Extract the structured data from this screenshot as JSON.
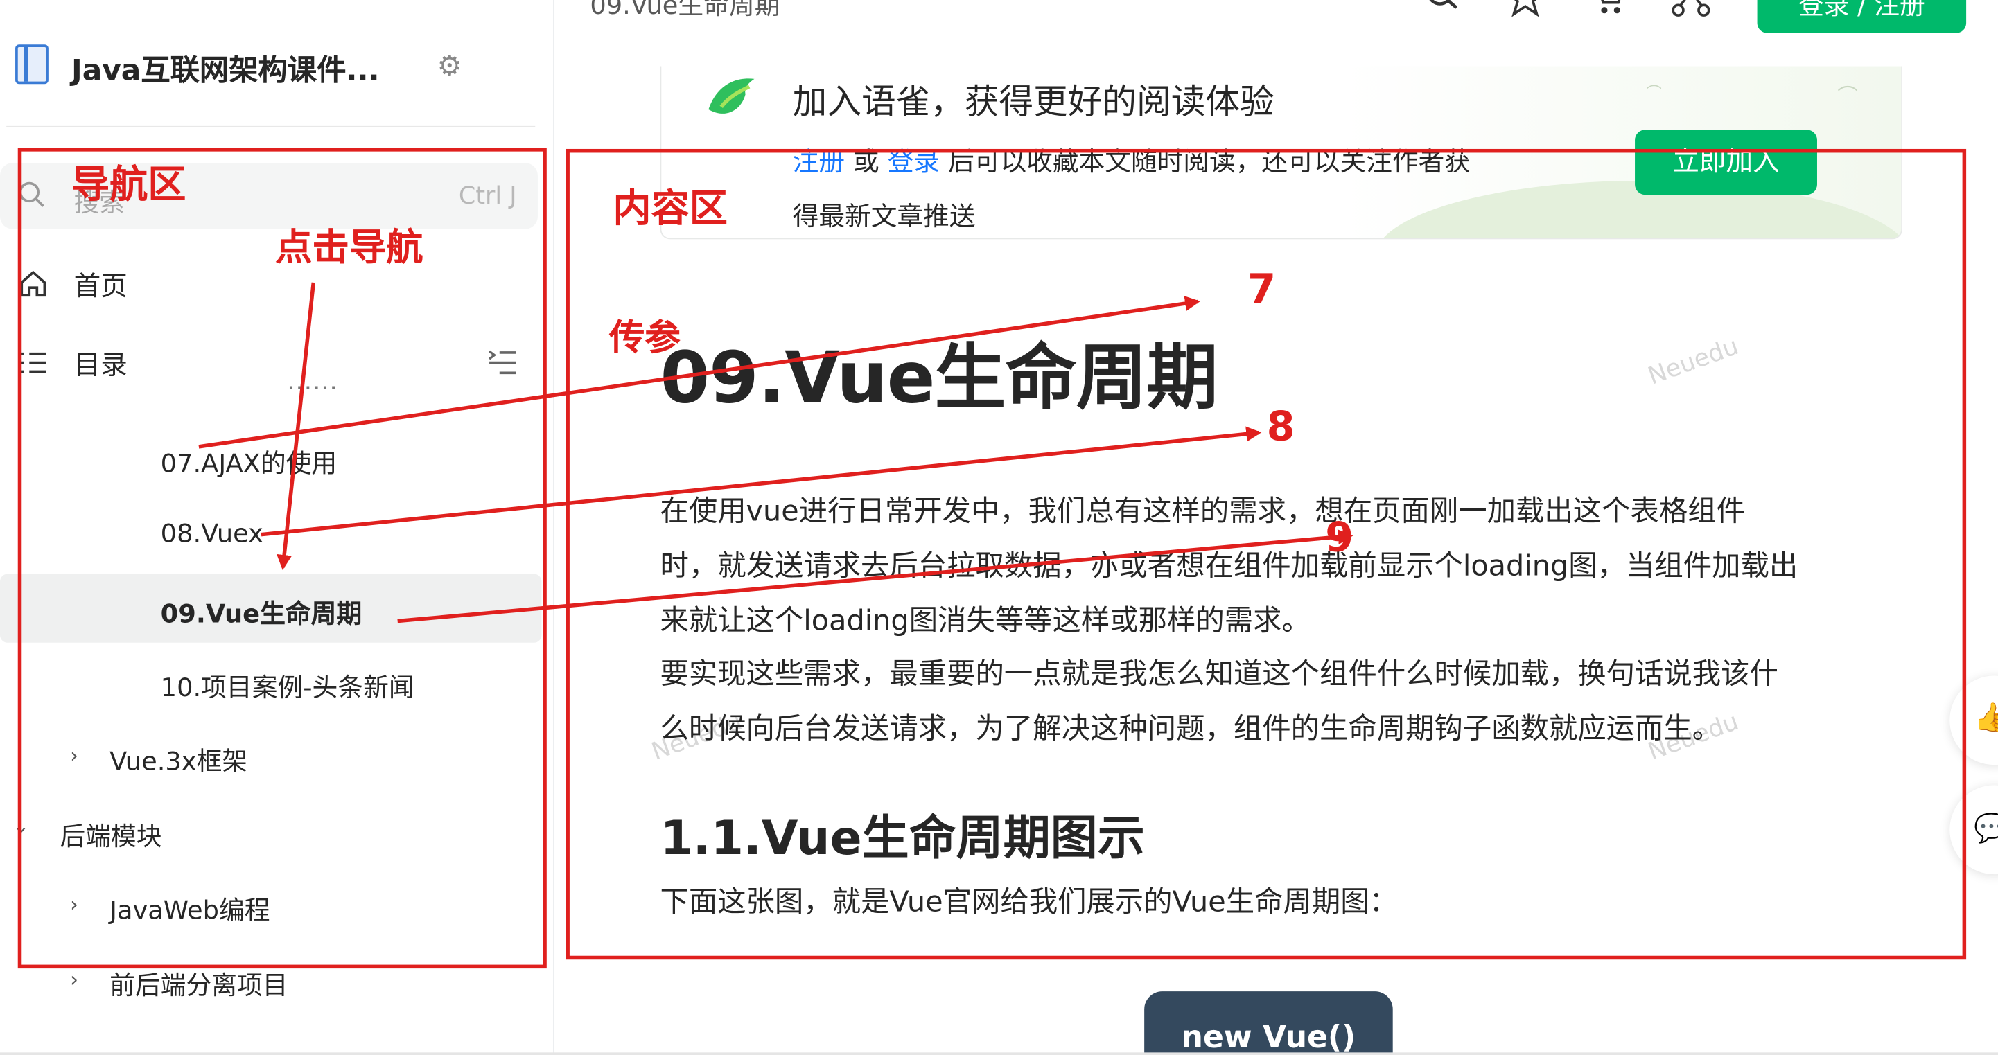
{
  "sidebar": {
    "book_title": "Java互联网架构课件...",
    "search": {
      "placeholder": "搜索",
      "shortcut": "Ctrl J"
    },
    "nav": {
      "home": "首页",
      "catalog": "目录"
    },
    "toc": [
      {
        "label": "07.AJAX的使用"
      },
      {
        "label": "08.Vuex"
      },
      {
        "label": "09.Vue生命周期",
        "active": true
      },
      {
        "label": "10.项目案例-头条新闻"
      },
      {
        "label": "Vue.3x框架",
        "expandable": true
      },
      {
        "label": "后端模块",
        "expanded": true
      },
      {
        "label": "JavaWeb编程",
        "expandable": true
      },
      {
        "label": "前后端分离项目",
        "expandable": true
      }
    ]
  },
  "header": {
    "breadcrumb": "09.Vue生命周期",
    "login_label": "登录 / 注册"
  },
  "banner": {
    "title": "加入语雀，获得更好的阅读体验",
    "register": "注册",
    "or": " 或 ",
    "login": "登录",
    "desc1_rest": " 后可以收藏本文随时阅读，还可以关注作者获",
    "desc2": "得最新文章推送",
    "join": "立即加入"
  },
  "article": {
    "title": "09.Vue生命周期",
    "paragraph_lines": [
      "在使用vue进行日常开发中，我们总有这样的需求，想在页面刚一加载出这个表格组件",
      "时，就发送请求去后台拉取数据，亦或者想在组件加载前显示个loading图，当组件加载出",
      "来就让这个loading图消失等等这样或那样的需求。",
      "要实现这些需求，最重要的一点就是我怎么知道这个组件什么时候加载，换句话说我该什",
      "么时候向后台发送请求，为了解决这种问题，组件的生命周期钩子函数就应运而生。"
    ],
    "subtitle": "1.1.Vue生命周期图示",
    "intro": "下面这张图，就是Vue官网给我们展示的Vue生命周期图：",
    "diagram_start": "new Vue()",
    "watermark": "Neuedu"
  },
  "annotations": {
    "nav_area": "导航区",
    "click_nav": "点击导航",
    "content_area": "内容区",
    "pass_param": "传参",
    "num7": "7",
    "num8": "8",
    "num9": "9",
    "color": "#e0201e"
  },
  "colors": {
    "accent": "#00b96b",
    "link": "#1677ff",
    "active_bg": "#eff0f0"
  }
}
